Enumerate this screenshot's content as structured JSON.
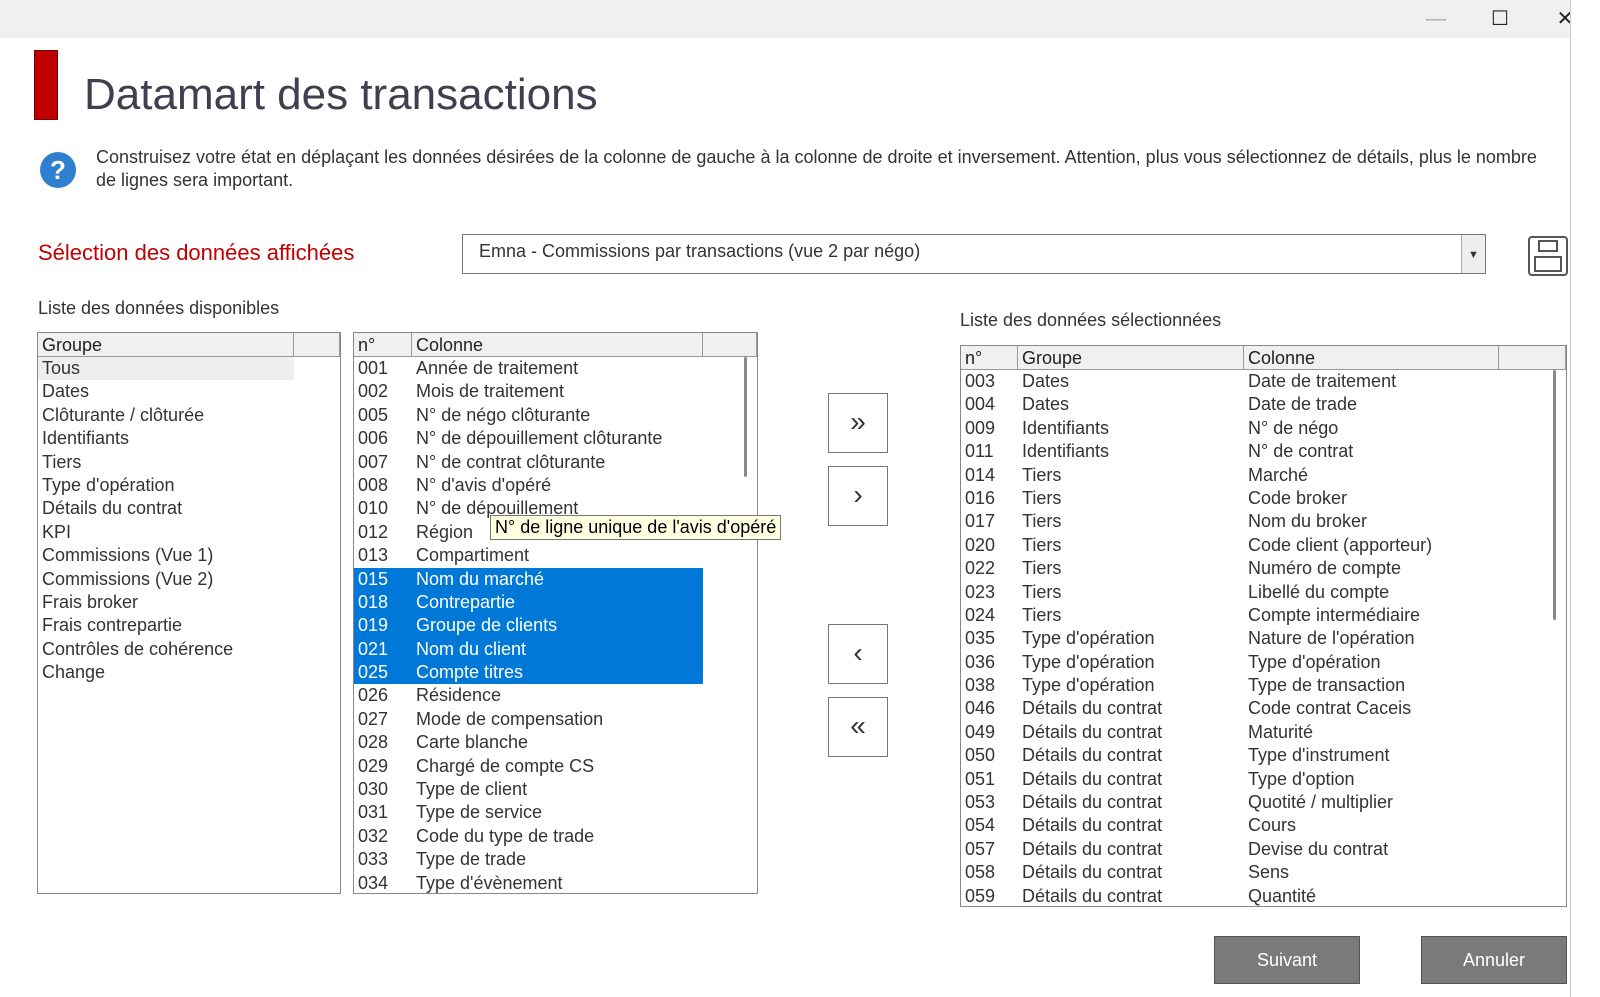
{
  "window": {
    "minimize": "—",
    "maximize": "☐",
    "close": "✕"
  },
  "title": "Datamart des transactions",
  "intro": "Construisez votre état en déplaçant les données désirées de la colonne de gauche à la colonne de droite et inversement. Attention, plus vous sélectionnez de détails, plus le nombre de lignes sera important.",
  "selection_title": "Sélection des données affichées",
  "view_select": "Emna - Commissions par transactions (vue 2 par négo)",
  "available_label": "Liste des données disponibles",
  "selected_label": "Liste des données sélectionnées",
  "groups": {
    "header": "Groupe",
    "items": [
      "Tous",
      "Dates",
      "Clôturante / clôturée",
      "Identifiants",
      "Tiers",
      "Type d'opération",
      "Détails du contrat",
      "KPI",
      "Commissions (Vue 1)",
      "Commissions (Vue 2)",
      "Frais broker",
      "Frais contrepartie",
      "Contrôles de cohérence",
      "Change"
    ]
  },
  "available": {
    "headers": [
      "n°",
      "Colonne"
    ],
    "rows": [
      [
        "001",
        "Année de traitement",
        false
      ],
      [
        "002",
        "Mois de traitement",
        false
      ],
      [
        "005",
        "N° de négo clôturante",
        false
      ],
      [
        "006",
        "N° de dépouillement clôturante",
        false
      ],
      [
        "007",
        "N° de contrat clôturante",
        false
      ],
      [
        "008",
        "N° d'avis d'opéré",
        false
      ],
      [
        "010",
        "N° de dépouillement",
        false
      ],
      [
        "012",
        "Région",
        false
      ],
      [
        "013",
        "Compartiment",
        false
      ],
      [
        "015",
        "Nom du marché",
        true
      ],
      [
        "018",
        "Contrepartie",
        true
      ],
      [
        "019",
        "Groupe de clients",
        true
      ],
      [
        "021",
        "Nom du client",
        true
      ],
      [
        "025",
        "Compte titres",
        true
      ],
      [
        "026",
        "Résidence",
        false
      ],
      [
        "027",
        "Mode de compensation",
        false
      ],
      [
        "028",
        "Carte blanche",
        false
      ],
      [
        "029",
        "Chargé de compte CS",
        false
      ],
      [
        "030",
        "Type de client",
        false
      ],
      [
        "031",
        "Type de service",
        false
      ],
      [
        "032",
        "Code du type de trade",
        false
      ],
      [
        "033",
        "Type de trade",
        false
      ],
      [
        "034",
        "Type d'évènement",
        false
      ]
    ]
  },
  "tooltip": "N° de ligne unique de l'avis d'opéré",
  "selected": {
    "headers": [
      "n°",
      "Groupe",
      "Colonne"
    ],
    "rows": [
      [
        "003",
        "Dates",
        "Date de traitement"
      ],
      [
        "004",
        "Dates",
        "Date de trade"
      ],
      [
        "009",
        "Identifiants",
        "N° de négo"
      ],
      [
        "011",
        "Identifiants",
        "N° de contrat"
      ],
      [
        "014",
        "Tiers",
        "Marché"
      ],
      [
        "016",
        "Tiers",
        "Code broker"
      ],
      [
        "017",
        "Tiers",
        "Nom du broker"
      ],
      [
        "020",
        "Tiers",
        "Code client (apporteur)"
      ],
      [
        "022",
        "Tiers",
        "Numéro de compte"
      ],
      [
        "023",
        "Tiers",
        "Libellé du compte"
      ],
      [
        "024",
        "Tiers",
        "Compte intermédiaire"
      ],
      [
        "035",
        "Type d'opération",
        "Nature de l'opération"
      ],
      [
        "036",
        "Type d'opération",
        "Type d'opération"
      ],
      [
        "038",
        "Type d'opération",
        "Type de transaction"
      ],
      [
        "046",
        "Détails du contrat",
        "Code contrat Caceis"
      ],
      [
        "049",
        "Détails du contrat",
        "Maturité"
      ],
      [
        "050",
        "Détails du contrat",
        "Type d'instrument"
      ],
      [
        "051",
        "Détails du contrat",
        "Type d'option"
      ],
      [
        "053",
        "Détails du contrat",
        "Quotité / multiplier"
      ],
      [
        "054",
        "Détails du contrat",
        "Cours"
      ],
      [
        "057",
        "Détails du contrat",
        "Devise du contrat"
      ],
      [
        "058",
        "Détails du contrat",
        "Sens"
      ],
      [
        "059",
        "Détails du contrat",
        "Quantité"
      ]
    ]
  },
  "move": {
    "all_right": "»",
    "right": "›",
    "left": "‹",
    "all_left": "«"
  },
  "buttons": {
    "next": "Suivant",
    "cancel": "Annuler"
  }
}
